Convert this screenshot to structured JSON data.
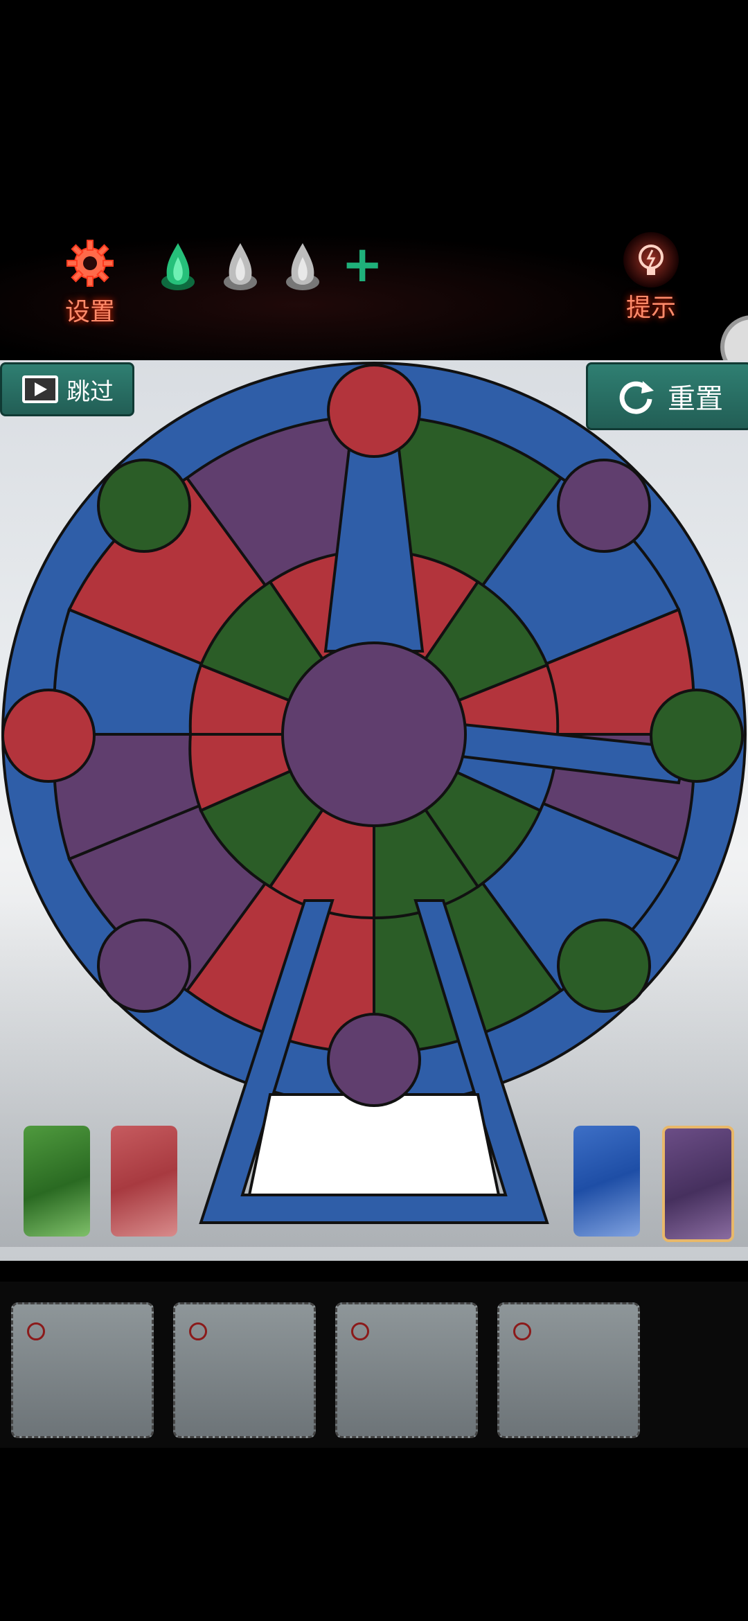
{
  "hud": {
    "settings_label": "设置",
    "hint_label": "提示",
    "flames": [
      "green-flame",
      "gray-flame",
      "gray-flame"
    ],
    "plus": "+"
  },
  "buttons": {
    "skip_label": "跳过",
    "reset_label": "重置"
  },
  "palette": {
    "red": "#b3343c",
    "blue": "#2f5ea8",
    "green": "#2b5d27",
    "purple": "#603e6e",
    "white": "#ffffff",
    "button_teal": "#2f7f72",
    "hud_red": "#ff8a6a"
  },
  "swatches": [
    {
      "color": "green",
      "selected": false
    },
    {
      "color": "red",
      "selected": false
    },
    {
      "color": "blue",
      "selected": false
    },
    {
      "color": "purple",
      "selected": true
    }
  ],
  "inventory_slots": 4
}
